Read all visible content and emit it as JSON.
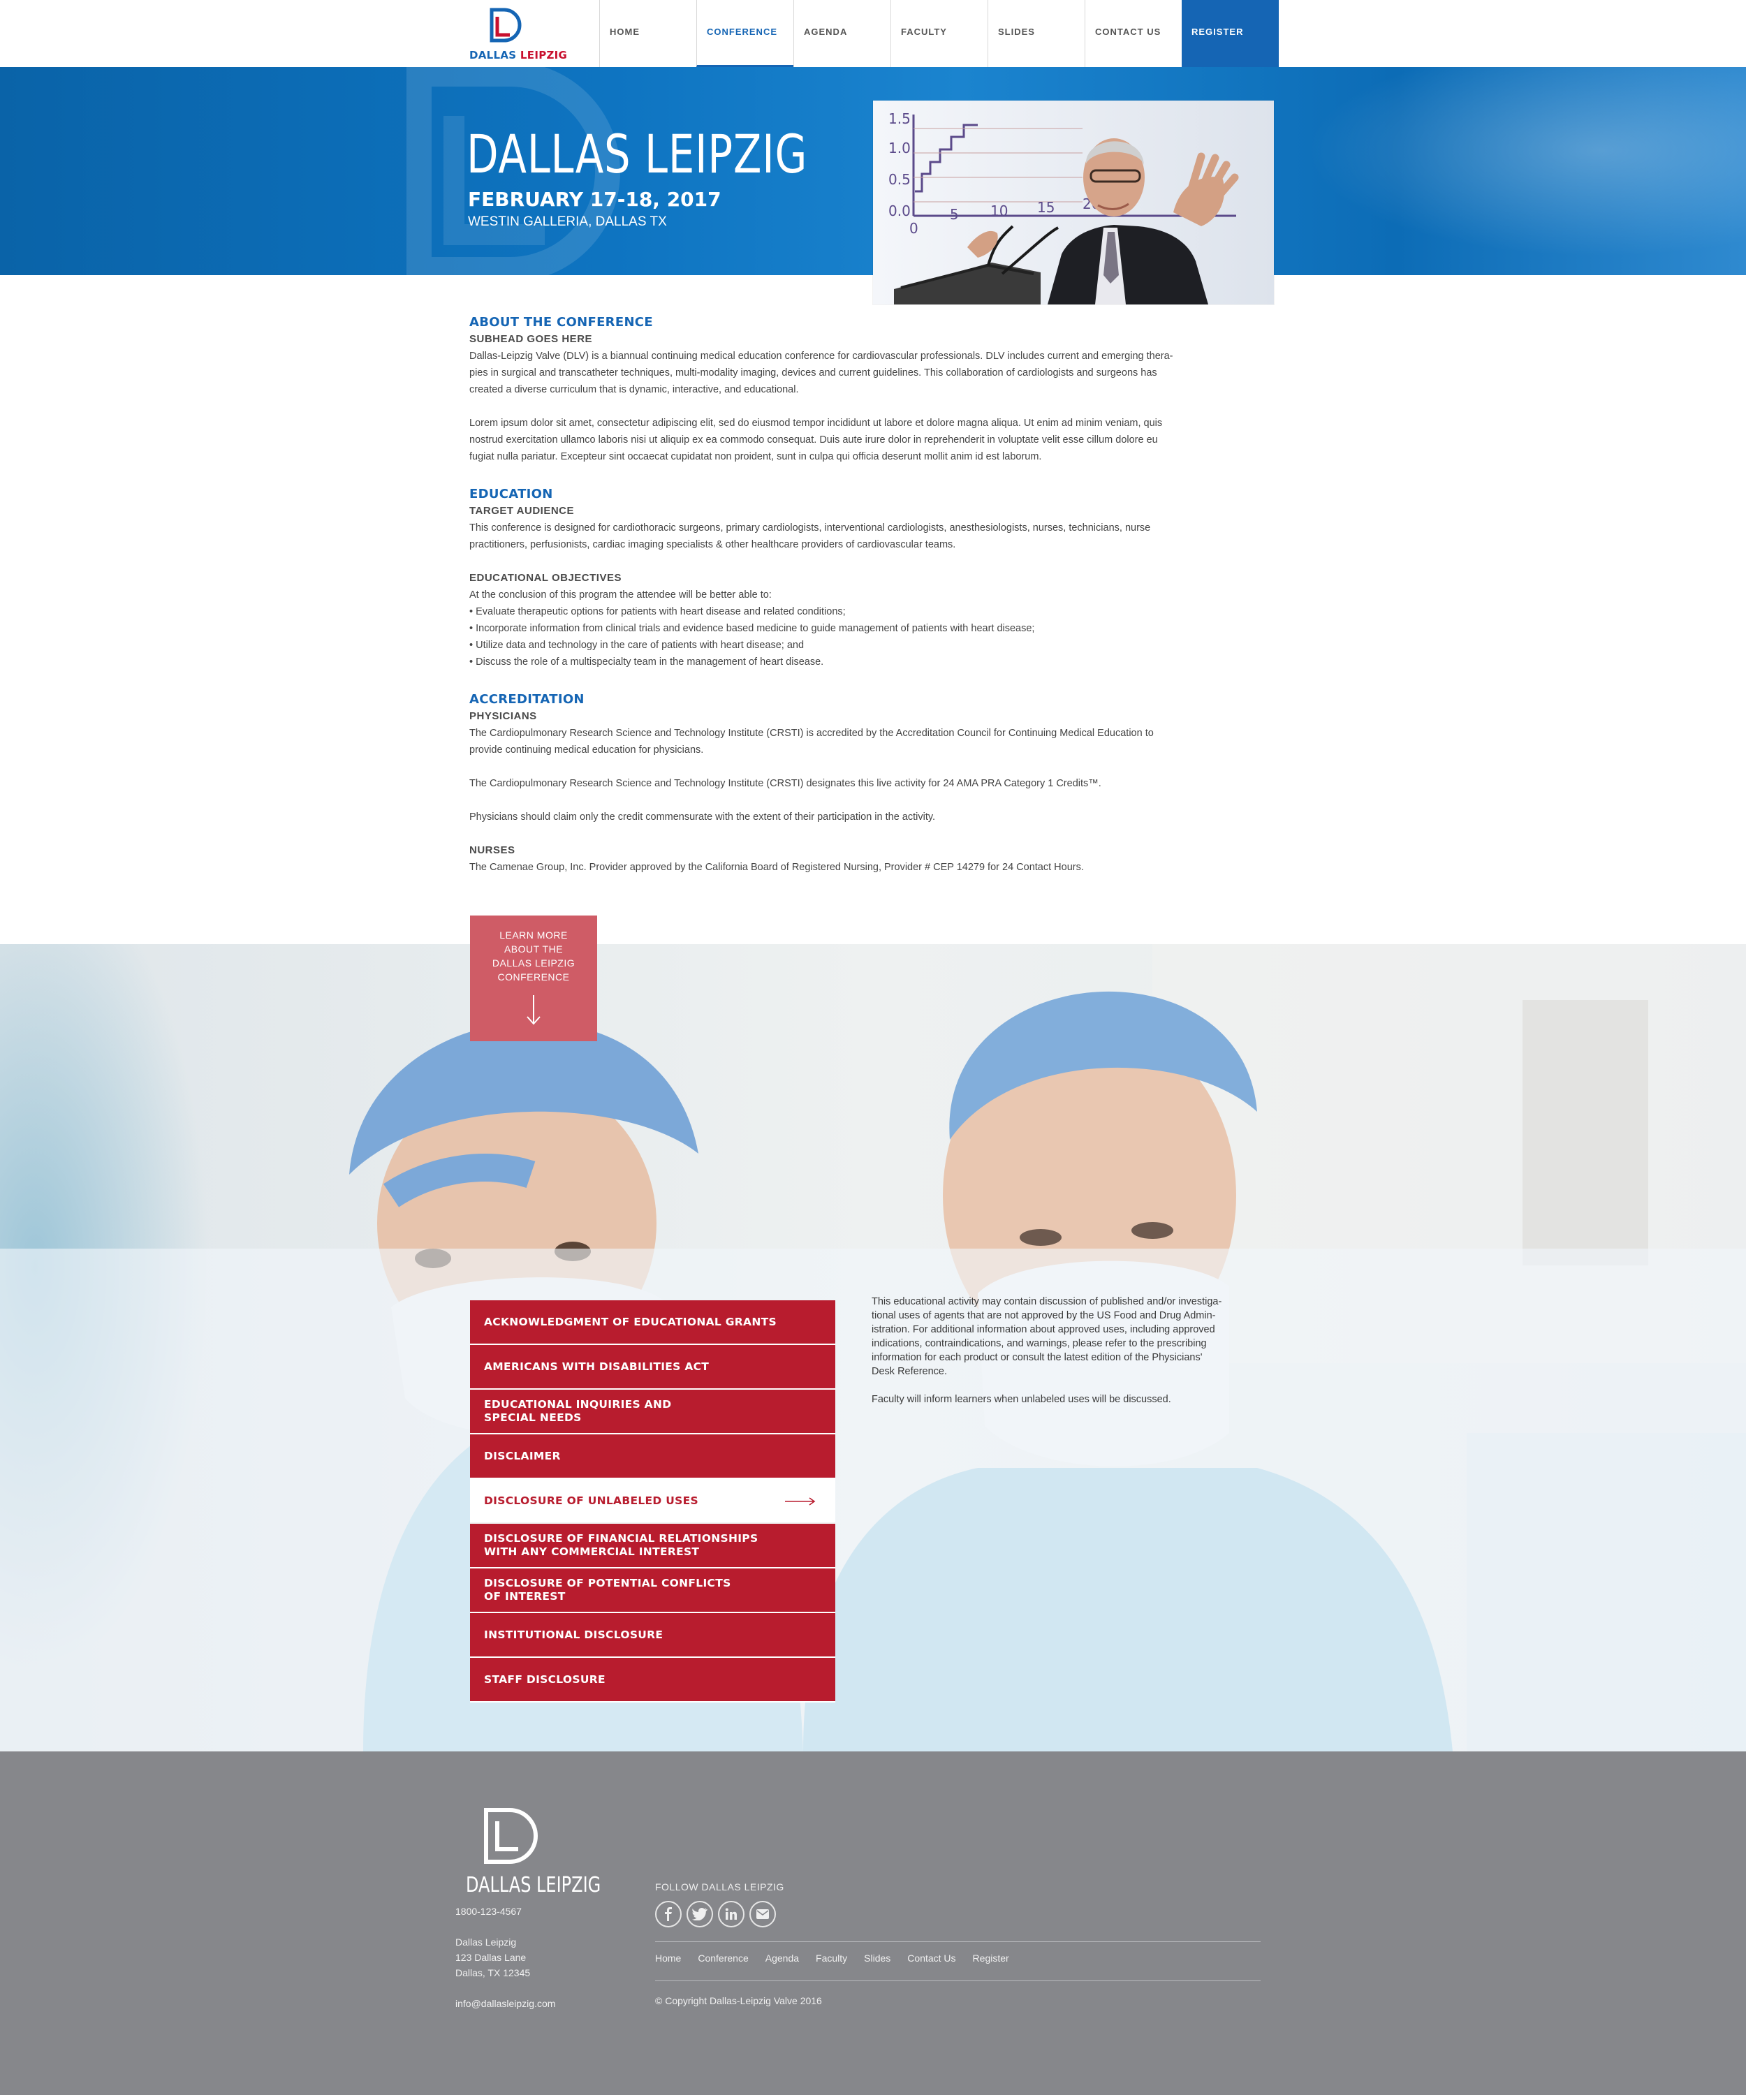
{
  "brand": {
    "word_a": "DALLAS ",
    "word_b": "LEIPZIG",
    "blue": "#1565b4",
    "red": "#c8102e"
  },
  "nav": {
    "items": [
      {
        "label": "HOME"
      },
      {
        "label": "CONFERENCE",
        "active": true
      },
      {
        "label": "AGENDA"
      },
      {
        "label": "FACULTY"
      },
      {
        "label": "SLIDES"
      },
      {
        "label": "CONTACT US"
      },
      {
        "label": "REGISTER"
      }
    ]
  },
  "hero": {
    "title": "DALLAS LEIPZIG",
    "date": "FEBRUARY 17-18, 2017",
    "venue": "WESTIN GALLERIA, DALLAS TX",
    "chart_ticks_y": [
      "1.5",
      "1.0",
      "0.5",
      "0.0"
    ],
    "chart_ticks_x": [
      "0",
      "5",
      "10",
      "15",
      "20"
    ]
  },
  "about": {
    "heading": "ABOUT THE CONFERENCE",
    "subhead": "SUBHEAD GOES HERE",
    "p1_lines": [
      "Dallas-Leipzig Valve (DLV) is a biannual continuing medical education conference for cardiovascular professionals. DLV includes current and emerging thera-",
      "pies in surgical and transcatheter techniques, multi-modality imaging, devices and current guidelines. This collaboration of cardiologists and surgeons has",
      "created a diverse curriculum that is dynamic, interactive, and educational."
    ],
    "p2_lines": [
      "Lorem ipsum dolor sit amet, consectetur adipiscing elit, sed do eiusmod tempor incididunt ut labore et dolore magna aliqua. Ut enim ad minim veniam, quis",
      "nostrud exercitation ullamco laboris nisi ut aliquip ex ea commodo consequat. Duis aute irure dolor in reprehenderit in voluptate velit esse cillum dolore eu",
      "fugiat nulla pariatur. Excepteur sint occaecat cupidatat non proident, sunt in culpa qui officia deserunt mollit anim id est laborum."
    ]
  },
  "education": {
    "heading": "EDUCATION",
    "audience_head": "TARGET AUDIENCE",
    "audience_lines": [
      "This conference is designed for cardiothoracic surgeons, primary cardiologists, interventional cardiologists, anesthesiologists, nurses, technicians, nurse",
      "practitioners, perfusionists, cardiac imaging specialists & other healthcare providers of cardiovascular teams."
    ],
    "objectives_head": "EDUCATIONAL OBJECTIVES",
    "objectives_intro": "At the conclusion of this program the attendee will be better able to:",
    "objectives": [
      "• Evaluate therapeutic options for patients with heart disease and related conditions;",
      "• Incorporate information from clinical trials and evidence based medicine to guide management of patients with heart disease;",
      "• Utilize data and technology in the care of patients with heart disease; and",
      "• Discuss the role of a multispecialty team in the management of heart disease."
    ]
  },
  "accreditation": {
    "heading": "ACCREDITATION",
    "physicians_head": "PHYSICIANS",
    "phys_p1_lines": [
      "The Cardiopulmonary Research Science and Technology Institute (CRSTI) is accredited by the Accreditation Council for Continuing Medical Education to",
      "provide continuing medical education for physicians."
    ],
    "phys_p2": "The Cardiopulmonary Research Science and Technology Institute (CRSTI) designates this live activity for 24 AMA PRA Category 1 Credits™.",
    "phys_p3": "Physicians should claim only the credit commensurate with the extent of their participation in the activity.",
    "nurses_head": "NURSES",
    "nurses_p": "The Camenae Group, Inc. Provider approved by the California Board of Registered Nursing, Provider # CEP 14279 for 24 Contact Hours."
  },
  "learn_more": {
    "lines": [
      "LEARN MORE",
      "ABOUT THE",
      "DALLAS LEIPZIG",
      "CONFERENCE"
    ]
  },
  "accordion": {
    "items": [
      {
        "lines": [
          "ACKNOWLEDGMENT OF EDUCATIONAL GRANTS"
        ]
      },
      {
        "lines": [
          "AMERICANS WITH DISABILITIES ACT"
        ]
      },
      {
        "lines": [
          "EDUCATIONAL INQUIRIES AND",
          "SPECIAL NEEDS"
        ]
      },
      {
        "lines": [
          "DISCLAIMER"
        ]
      },
      {
        "lines": [
          "DISCLOSURE OF UNLABELED USES"
        ],
        "active": true
      },
      {
        "lines": [
          "DISCLOSURE OF FINANCIAL RELATIONSHIPS",
          "WITH ANY COMMERCIAL INTEREST"
        ]
      },
      {
        "lines": [
          "DISCLOSURE OF POTENTIAL CONFLICTS",
          "OF INTEREST"
        ]
      },
      {
        "lines": [
          "INSTITUTIONAL DISCLOSURE"
        ]
      },
      {
        "lines": [
          "STAFF DISCLOSURE"
        ]
      }
    ],
    "red": "#b81c2e"
  },
  "disclosure": {
    "p1_lines": [
      "This educational activity may contain discussion of published and/or investiga-",
      "tional uses of agents that are not approved by the US Food and Drug Admin-",
      "istration. For additional information about approved uses, including approved",
      "indications, contraindications, and warnings, please refer to the prescribing",
      "information for each product or consult the latest edition of the Physicians'",
      "Desk Reference."
    ],
    "p2": "Faculty will inform learners when unlabeled uses will be discussed."
  },
  "footer": {
    "logo_word": "DALLAS LEIPZIG",
    "phone": "1800-123-4567",
    "address_lines": [
      "Dallas Leipzig",
      "123 Dallas Lane",
      "Dallas, TX 12345"
    ],
    "email": "info@dallasleipzig.com",
    "follow": "FOLLOW DALLAS LEIPZIG",
    "social": [
      "facebook-icon",
      "twitter-icon",
      "linkedin-icon",
      "mail-icon"
    ],
    "links": [
      "Home",
      "Conference",
      "Agenda",
      "Faculty",
      "Slides",
      "Contact Us",
      "Register"
    ],
    "copyright": "© Copyright Dallas-Leipzig Valve 2016",
    "bg": "#86878b"
  }
}
